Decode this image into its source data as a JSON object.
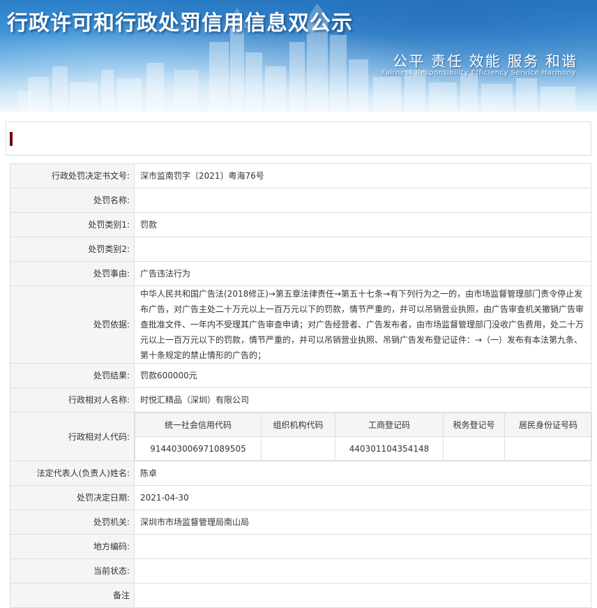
{
  "header": {
    "title": "行政许可和行政处罚信用信息双公示",
    "slogan_cn": "公平  责任  效能  服务  和谐",
    "slogan_en": "Fairness  Responsibility  Efficiency  Service  Harmony"
  },
  "colors": {
    "section_mark": "#6b0d12",
    "label_bg": "#f5f5f5",
    "border": "#dedede",
    "banner_sky": "#3f95d8"
  },
  "rows": {
    "doc_no": {
      "label": "行政处罚决定书文号:",
      "value": "深市监南罚字〔2021〕粤海76号"
    },
    "penalty_name": {
      "label": "处罚名称:",
      "value": ""
    },
    "category1": {
      "label": "处罚类别1:",
      "value": "罚款"
    },
    "category2": {
      "label": "处罚类别2:",
      "value": ""
    },
    "reason": {
      "label": "处罚事由:",
      "value": "广告违法行为"
    },
    "basis": {
      "label": "处罚依据:",
      "value": "中华人民共和国广告法(2018修正)→第五章法律责任→第五十七条→有下列行为之一的，由市场监督管理部门责令停止发布广告，对广告主处二十万元以上一百万元以下的罚款，情节严重的，并可以吊销营业执照，由广告审查机关撤销广告审查批准文件、一年内不受理其广告审查申请；对广告经营者、广告发布者，由市场监督管理部门没收广告费用，处二十万元以上一百万元以下的罚款，情节严重的，并可以吊销营业执照、吊销广告发布登记证件：→（一）发布有本法第九条、第十条规定的禁止情形的广告的；"
    },
    "result": {
      "label": "处罚结果:",
      "value": "罚款600000元"
    },
    "party_name": {
      "label": "行政相对人名称:",
      "value": "时悦汇精品（深圳）有限公司"
    },
    "party_code": {
      "label": "行政相对人代码:",
      "headers": [
        "统一社会信用代码",
        "组织机构代码",
        "工商登记码",
        "税务登记号",
        "居民身份证号码"
      ],
      "values": [
        "914403006971089505",
        "",
        "440301104354148",
        "",
        ""
      ]
    },
    "legal_rep": {
      "label": "法定代表人(负责人)姓名:",
      "value": "陈卓"
    },
    "decision_date": {
      "label": "处罚决定日期:",
      "value": "2021-04-30"
    },
    "authority": {
      "label": "处罚机关:",
      "value": "深圳市市场监督管理局南山局"
    },
    "region_code": {
      "label": "地方编码:",
      "value": ""
    },
    "status": {
      "label": "当前状态:",
      "value": ""
    },
    "remarks": {
      "label": "备注",
      "value": ""
    }
  }
}
